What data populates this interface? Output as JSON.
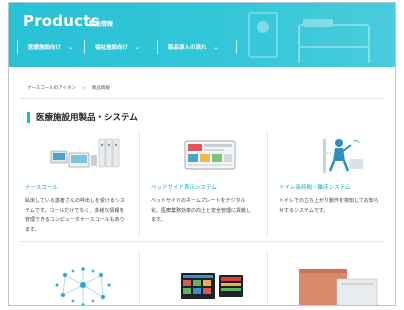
{
  "hero": {
    "title": "Products",
    "subtitle": "製品情報",
    "nav": [
      {
        "label": "医療施設向け"
      },
      {
        "label": "福祉施設向け"
      },
      {
        "label": "製品導入の流れ"
      }
    ],
    "colors": {
      "banner": "#2ec3d7",
      "accent": "#22b6cc"
    }
  },
  "breadcrumb": {
    "items": [
      "ナースコールのアイホン",
      "製品情報"
    ],
    "separator": ">"
  },
  "section": {
    "title": "医療施設用製品・システム"
  },
  "products": [
    {
      "name": "ナースコール",
      "description": "臥床している患者さんの呼出しを受けるシステムです。コールだけでなく、多様な情報を管理できるコンピュータナースコールもあります。",
      "icon": "nurse-call-system-image"
    },
    {
      "name": "ベッドサイド表示システム",
      "description": "ベッドサイドのネームプレートをデジタル化。医療業務効率の向上と安全管理に貢献します。",
      "icon": "bedside-display-image"
    },
    {
      "name": "トイレ長時間・離床システム",
      "description": "トイレでの立ち上がり動作を検知してお知らせするシステムです。",
      "icon": "toilet-detection-image"
    }
  ],
  "products_row2": [
    {
      "icon": "network-system-image"
    },
    {
      "icon": "monitor-display-image"
    },
    {
      "icon": "wall-panel-image"
    }
  ]
}
